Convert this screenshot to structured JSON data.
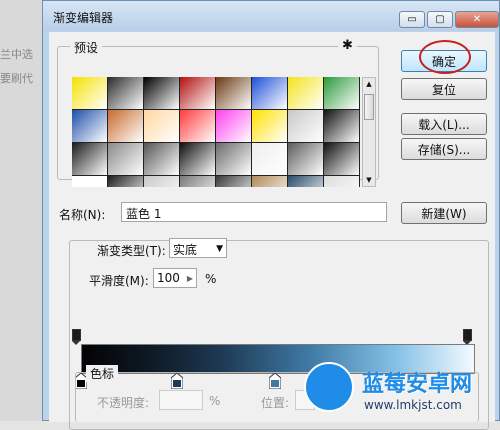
{
  "background": {
    "lines": [
      "兰中选",
      "要刷代"
    ]
  },
  "window": {
    "title": "渐变编辑器",
    "controls": {
      "minimize": "▭",
      "maximize": "▢",
      "close": "✕"
    }
  },
  "presets": {
    "label": "预设",
    "gear_glyph": "✱",
    "swatches": [
      [
        "#f5e000",
        "#2b2b2b",
        "#000000",
        "#b31010",
        "#6a3a14",
        "#1e4fd8",
        "#f3e31a",
        "#2a9a3a"
      ],
      [
        "#1c4ea8",
        "#c86a2c",
        "#ffd7a0",
        "#ff3b3b",
        "#ff3ff0",
        "#ffe000",
        "#c9c9c9",
        "#111111"
      ],
      [
        "#1a1a1a",
        "#8a8a8a",
        "#555555",
        "#0f0f0f",
        "#6a6a6a",
        "#eeeeee",
        "#5c5c5c",
        "#101010"
      ],
      [
        "#ffffff",
        "#1f1f1f",
        "#c9c9c9",
        "#7a7a7a",
        "#3a3a3a",
        "#b38a5a",
        "#2b4b6a",
        "#dddddd"
      ]
    ]
  },
  "buttons": {
    "ok": "确定",
    "reset": "复位",
    "load": "载入(L)...",
    "save": "存储(S)...",
    "new": "新建(W)"
  },
  "name_field": {
    "label": "名称(N):",
    "value": "蓝色 1"
  },
  "gradient_type": {
    "label": "渐变类型(T):",
    "value": "实底"
  },
  "smoothness": {
    "label": "平滑度(M):",
    "value": "100",
    "unit": "%"
  },
  "color_stops": {
    "label": "色标",
    "opacity_label": "不透明度:",
    "opacity_unit": "%",
    "position_label": "位置:"
  },
  "watermark": {
    "brand": "蓝莓安卓网",
    "url": "www.lmkjst.com"
  },
  "colors": {
    "highlight_circle": "#c81e1e",
    "brand": "#1f8de8"
  }
}
